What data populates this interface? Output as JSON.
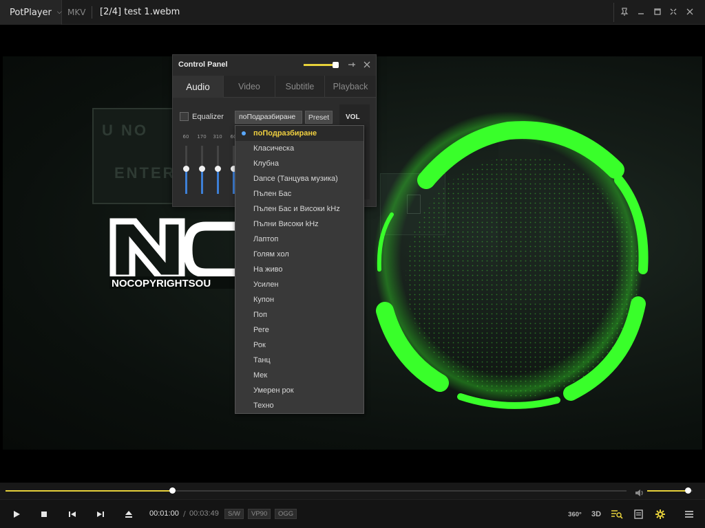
{
  "titlebar": {
    "app_name": "PotPlayer",
    "format": "MKV",
    "title": "[2/4] test 1.webm",
    "icons": [
      "pin-icon",
      "minimize-icon",
      "maximize-icon",
      "fullscreen-icon",
      "close-icon"
    ]
  },
  "video": {
    "logo_text": "NOCOPYRIGHTSOU",
    "sign_text_1": "U NO",
    "sign_text_2": "ENTER",
    "ring_color": "#39ff2a"
  },
  "control_panel": {
    "title": "Control Panel",
    "tabs": [
      {
        "label": "Audio",
        "active": true
      },
      {
        "label": "Video",
        "active": false
      },
      {
        "label": "Subtitle",
        "active": false
      },
      {
        "label": "Playback",
        "active": false
      }
    ],
    "equalizer_label": "Equalizer",
    "preset_value": "поПодразбиране",
    "preset_button": "Preset",
    "vol_label": "VOL",
    "bands": [
      "60",
      "170",
      "310",
      "60"
    ]
  },
  "preset_dropdown": {
    "items": [
      "поПодразбиране",
      "Класическа",
      "Клубна",
      "Dance (Танцува музика)",
      "Пълен Бас",
      "Пълен Бас и Високи kHz",
      "Пълни Високи kHz",
      "Лаптоп",
      "Голям хол",
      "На живо",
      "Усилен",
      "Купон",
      "Поп",
      "Реге",
      "Рок",
      "Танц",
      "Мек",
      "Умерен рок",
      "Техно"
    ],
    "selected_index": 0
  },
  "playback": {
    "progress": 0.268,
    "volume": 0.9,
    "time_current": "00:01:00",
    "time_separator": "/",
    "time_total": "00:03:49",
    "badges": [
      "S/W",
      "VP90",
      "OGG"
    ],
    "label_360": "360°",
    "label_3d": "3D",
    "accent_color": "#e9d33b"
  }
}
